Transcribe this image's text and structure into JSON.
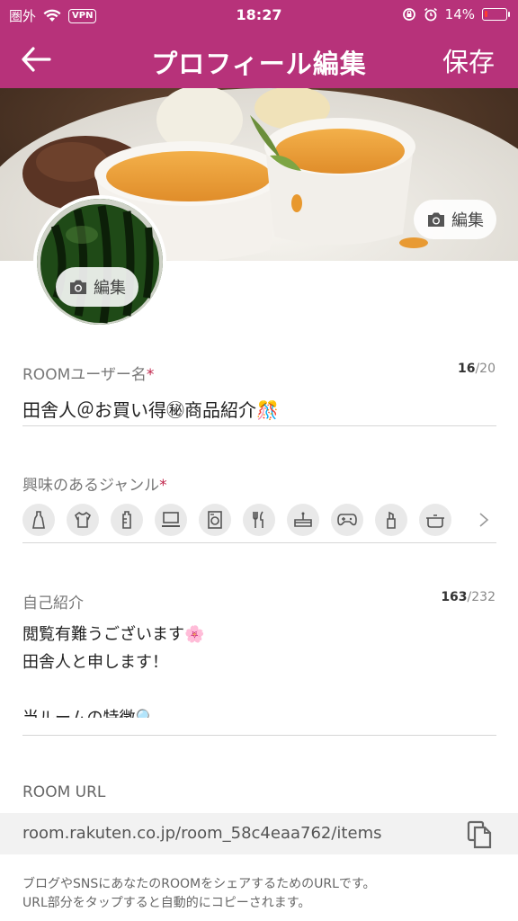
{
  "status": {
    "carrier": "圏外",
    "vpn": "VPN",
    "time": "18:27",
    "battery": "14%",
    "battery_level": 0.14
  },
  "nav": {
    "title": "プロフィール編集",
    "save": "保存",
    "back_icon": "arrow-left-icon"
  },
  "cover": {
    "edit_label": "編集"
  },
  "avatar": {
    "edit_label": "編集"
  },
  "username": {
    "label": "ROOMユーザー名",
    "required_mark": "*",
    "count": "16",
    "max": "/20",
    "value": "田舎人＠お買い得㊙商品紹介🎊"
  },
  "genres": {
    "label": "興味のあるジャンル",
    "required_mark": "*",
    "icons": [
      "dress-icon",
      "shirt-icon",
      "baby-bottle-icon",
      "computer-icon",
      "washing-machine-icon",
      "cutlery-icon",
      "cake-icon",
      "gamepad-icon",
      "lipstick-icon",
      "pot-icon"
    ]
  },
  "intro": {
    "label": "自己紹介",
    "count": "163",
    "max": "/232",
    "lines": [
      "閲覧有難うございます🌸",
      "田舎人と申します！",
      "",
      "当ルームの特徴🔍"
    ]
  },
  "url": {
    "label": "ROOM URL",
    "value": "room.rakuten.co.jp/room_58c4eaa762/items",
    "note_line1": "ブログやSNSにあなたのROOMをシェアするためのURLです。",
    "note_line2": "URL部分をタップすると自動的にコピーされます。"
  },
  "colors": {
    "brand": "#b7327a",
    "required": "#c0254b"
  }
}
